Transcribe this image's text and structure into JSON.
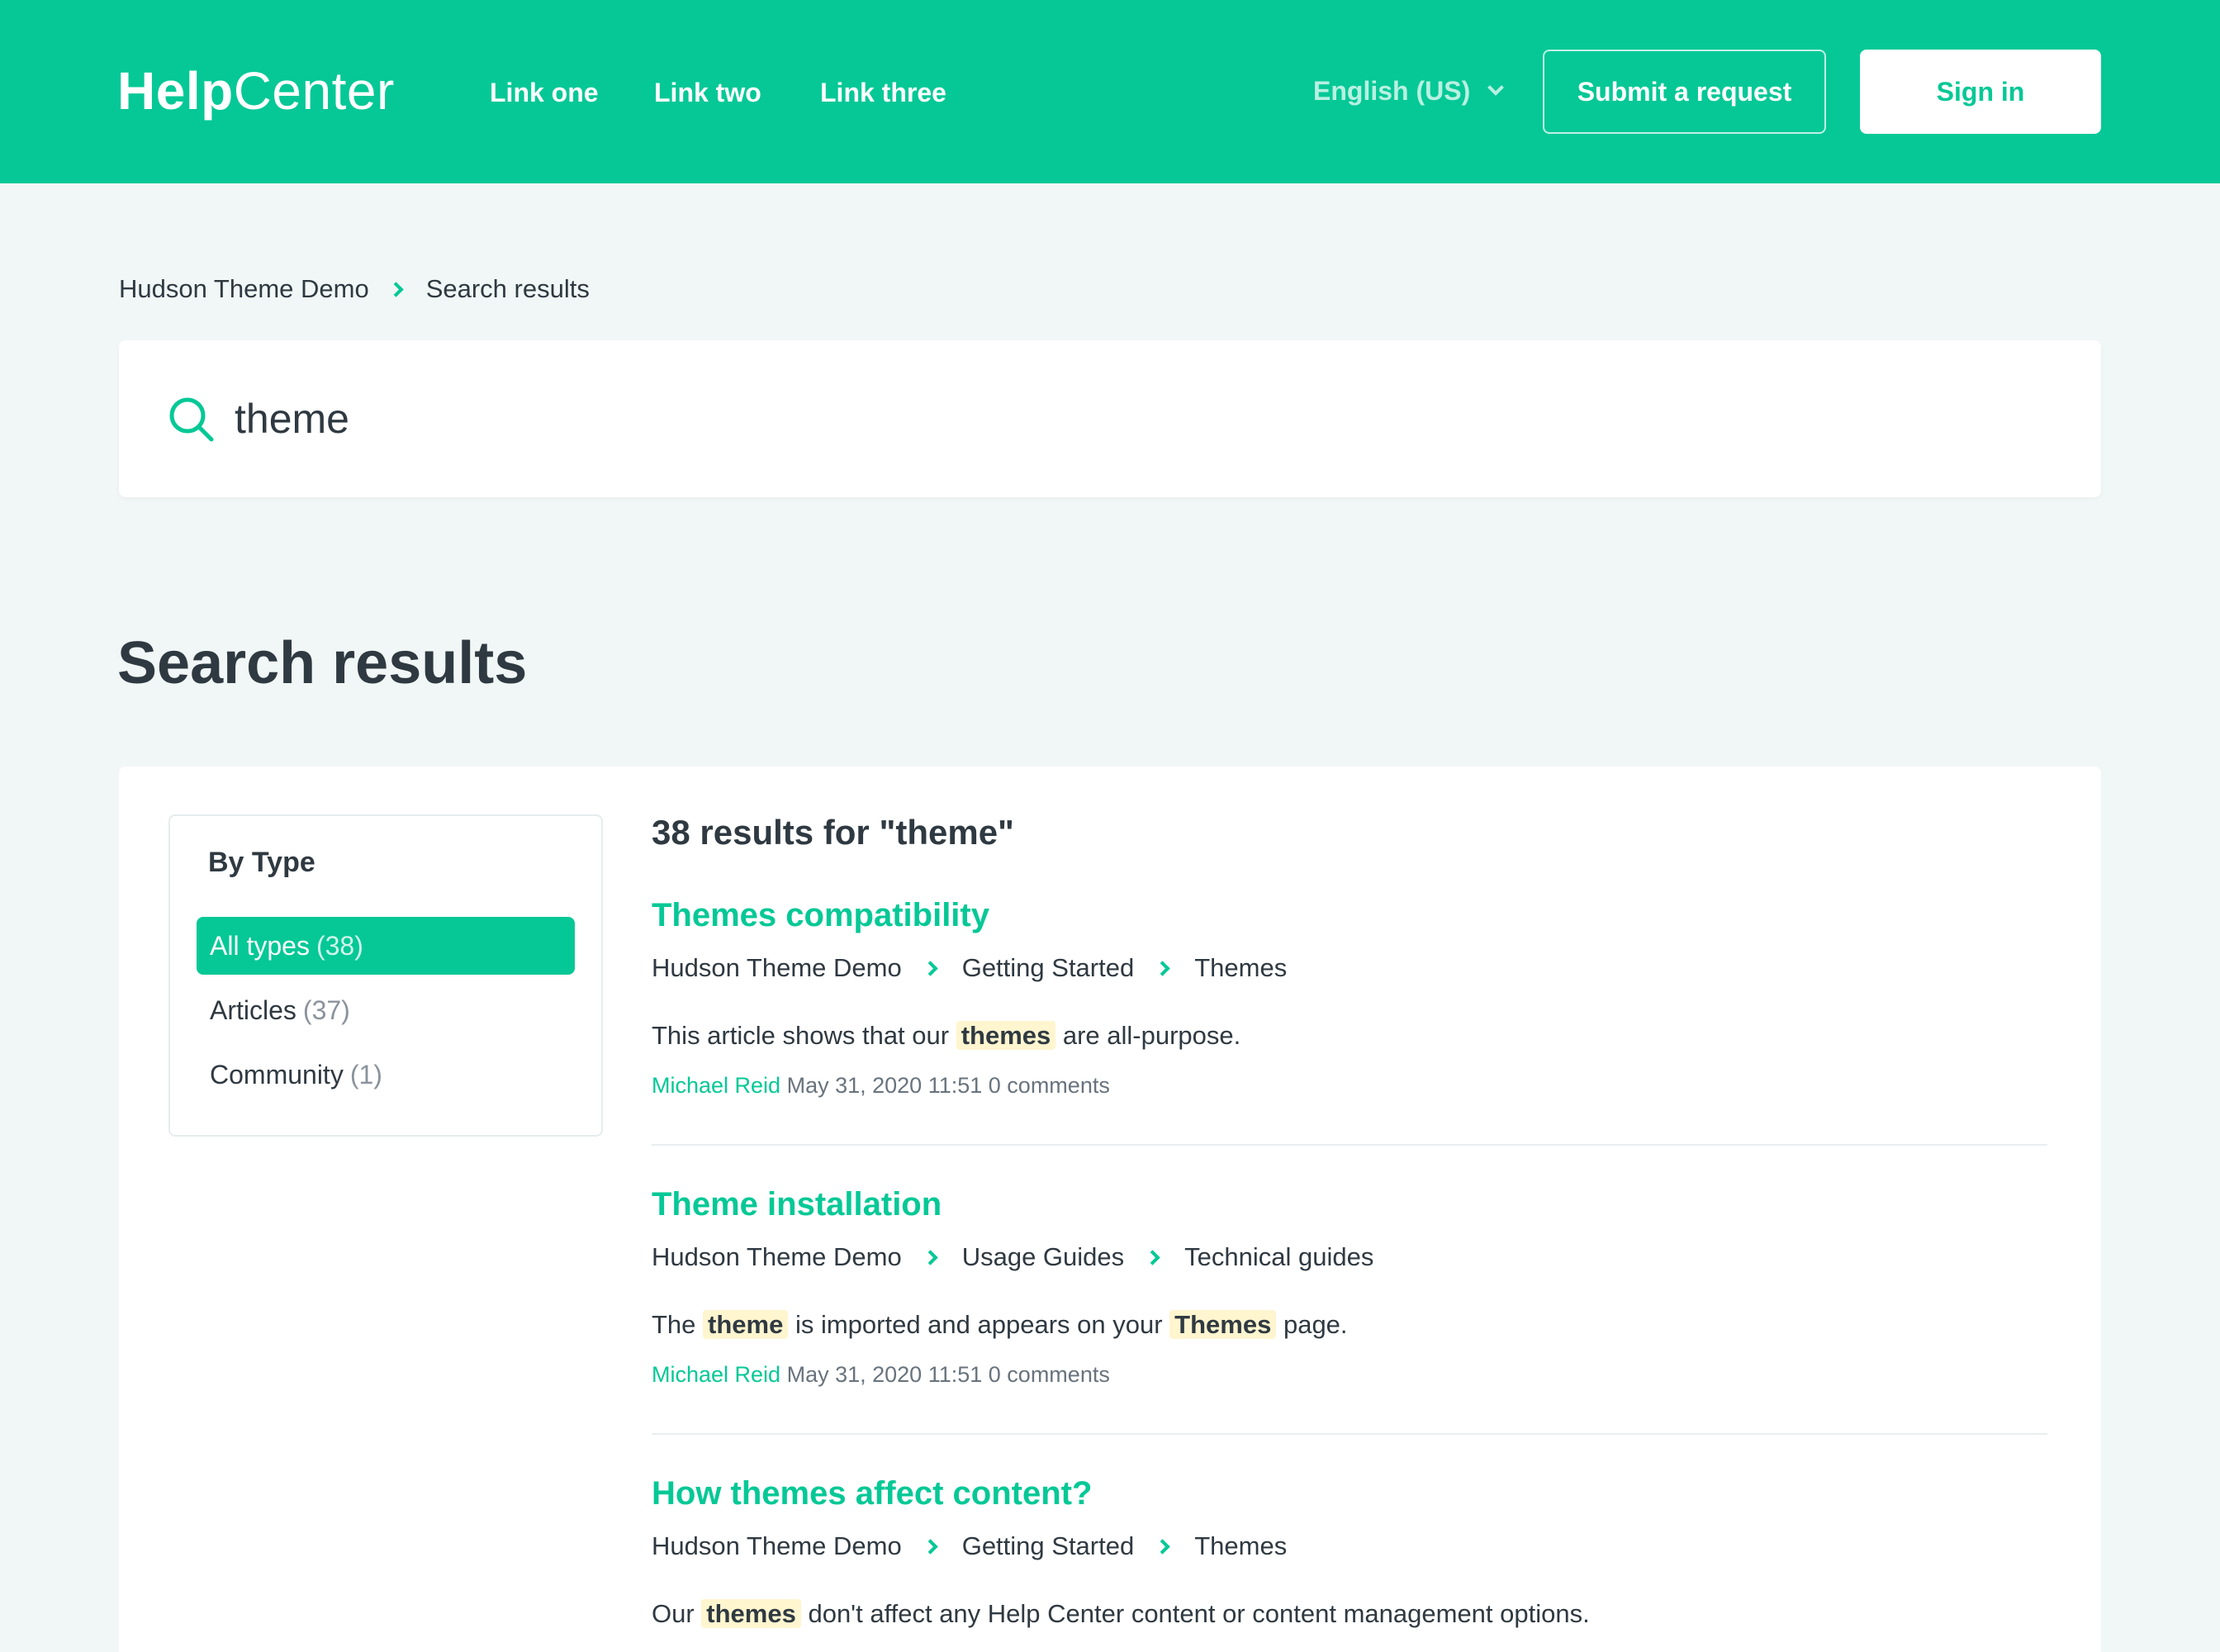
{
  "header": {
    "logo_bold": "Help",
    "logo_light": "Center",
    "nav": [
      "Link one",
      "Link two",
      "Link three"
    ],
    "language": "English (US)",
    "submit_label": "Submit a request",
    "signin_label": "Sign in",
    "brand_color": "#05c896"
  },
  "breadcrumb": [
    "Hudson Theme Demo",
    "Search results"
  ],
  "search": {
    "value": "theme",
    "icon": "search-icon"
  },
  "page_title": "Search results",
  "filter": {
    "title": "By Type",
    "items": [
      {
        "label": "All types",
        "count": "(38)",
        "active": true
      },
      {
        "label": "Articles",
        "count": "(37)",
        "active": false
      },
      {
        "label": "Community",
        "count": "(1)",
        "active": false
      }
    ]
  },
  "results_heading": "38 results for \"theme\"",
  "results": [
    {
      "title": "Themes compatibility",
      "crumbs": [
        "Hudson Theme Demo",
        "Getting Started",
        "Themes"
      ],
      "snippet": [
        {
          "text": "This article shows that our ",
          "hl": false
        },
        {
          "text": "themes",
          "hl": true
        },
        {
          "text": " are all-purpose.",
          "hl": false
        }
      ],
      "author": "Michael Reid",
      "date": "May 31, 2020 11:51",
      "comments": "0 comments"
    },
    {
      "title": "Theme installation",
      "crumbs": [
        "Hudson Theme Demo",
        "Usage Guides",
        "Technical guides"
      ],
      "snippet": [
        {
          "text": "The ",
          "hl": false
        },
        {
          "text": "theme",
          "hl": true
        },
        {
          "text": " is imported and appears on your ",
          "hl": false
        },
        {
          "text": "Themes",
          "hl": true
        },
        {
          "text": " page.",
          "hl": false
        }
      ],
      "author": "Michael Reid",
      "date": "May 31, 2020 11:51",
      "comments": "0 comments"
    },
    {
      "title": "How themes affect content?",
      "crumbs": [
        "Hudson Theme Demo",
        "Getting Started",
        "Themes"
      ],
      "snippet": [
        {
          "text": "Our ",
          "hl": false
        },
        {
          "text": "themes",
          "hl": true
        },
        {
          "text": " don't affect any Help Center content or content management options.",
          "hl": false
        }
      ]
    }
  ]
}
